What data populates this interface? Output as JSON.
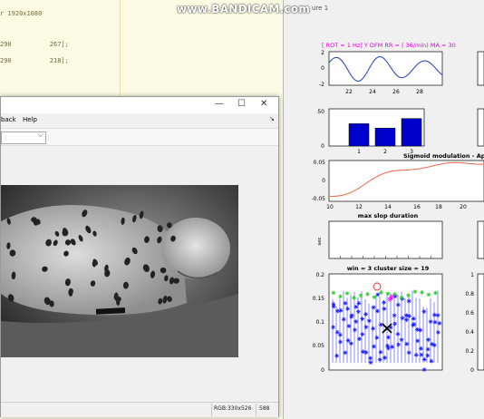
{
  "watermark": "www.BANDICAM.com",
  "editor": {
    "lines": [
      "r 1920x1080",
      "290          267];",
      "290          218];"
    ]
  },
  "figure": {
    "title": "ure 1",
    "panels": {
      "resp": {
        "title": "[ ROT = 1 Hz]  Y DFM RR = (  36/min)  MA = 30",
        "title_color": "#e000e0",
        "x_ticks": [
          "22",
          "24",
          "26",
          "28"
        ],
        "y_ticks": [
          "2",
          "0",
          "-2"
        ]
      },
      "bars": {
        "categories": [
          "1",
          "2",
          "3"
        ],
        "values": [
          30,
          24,
          37
        ],
        "y_ticks": [
          "50",
          "0"
        ],
        "bar_color": "#0000cc"
      },
      "sigmoid": {
        "title": "Sigmoid modulation - Apne",
        "x_ticks": [
          "10",
          "12",
          "14",
          "16",
          "18",
          "20"
        ],
        "y_ticks": [
          "0.05",
          "0",
          "-0.05"
        ],
        "line_color": "#e8735a"
      },
      "slope": {
        "title": "max slop duration",
        "ylabel": "sec"
      },
      "cluster": {
        "title": "win = 3 cluster size = 19",
        "y_ticks": [
          "0.2",
          "0.15",
          "0.1",
          "0.05",
          "0"
        ],
        "colors": {
          "blue": "#1a1aff",
          "green": "#22cc22",
          "magenta": "#ff22ff",
          "red": "#ff2222",
          "black": "#000000"
        }
      },
      "right_axis_ticks": [
        "1",
        "0.8",
        "0.6",
        "0.4",
        "0.2",
        "0"
      ]
    }
  },
  "viewer": {
    "menu": [
      "back",
      "Help"
    ],
    "window_buttons": [
      "—",
      "☐",
      "✕"
    ],
    "combo_arrow": "⌵",
    "status": {
      "rgb": "RGB:330x526",
      "value": "588"
    }
  }
}
